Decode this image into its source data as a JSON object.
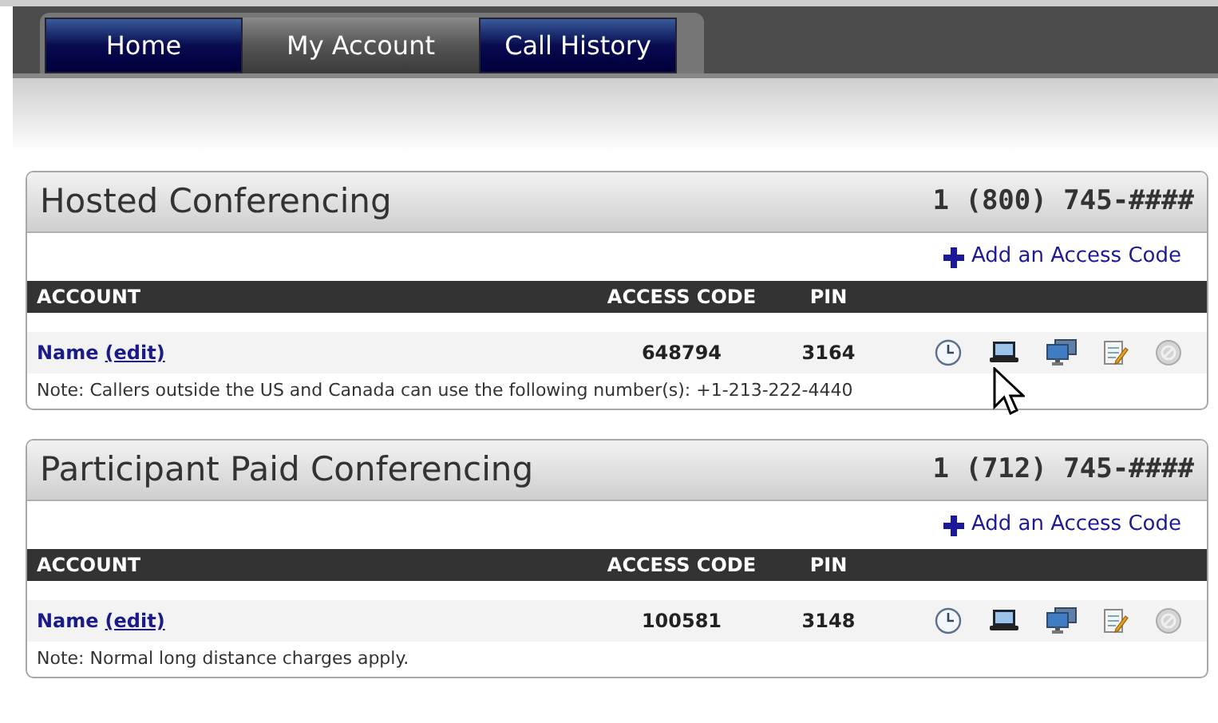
{
  "tabs": [
    {
      "label": "Home",
      "selected": false
    },
    {
      "label": "My Account",
      "selected": true
    },
    {
      "label": "Call History",
      "selected": false
    }
  ],
  "sections": [
    {
      "title": "Hosted Conferencing",
      "phone": "1 (800) 745-####",
      "add_label": "Add an Access Code",
      "columns": [
        "ACCOUNT",
        "ACCESS CODE",
        "PIN"
      ],
      "rows": [
        {
          "name": "Name",
          "edit": "(edit)",
          "access_code": "648794",
          "pin": "3164",
          "note": "Note: Callers outside the US and Canada can use the following number(s): +1-213-222-4440"
        }
      ]
    },
    {
      "title": "Participant Paid Conferencing",
      "phone": "1 (712) 745-####",
      "add_label": "Add an Access Code",
      "columns": [
        "ACCOUNT",
        "ACCESS CODE",
        "PIN"
      ],
      "rows": [
        {
          "name": "Name",
          "edit": "(edit)",
          "access_code": "100581",
          "pin": "3148",
          "note": "Note: Normal long distance charges apply."
        }
      ]
    }
  ]
}
